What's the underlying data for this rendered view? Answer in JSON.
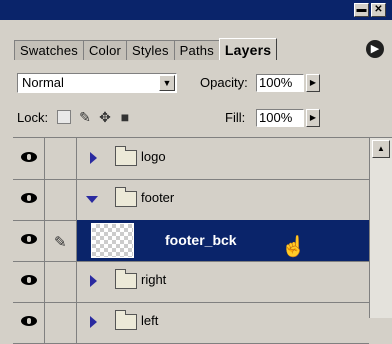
{
  "tabs": [
    {
      "label": "Swatches"
    },
    {
      "label": "Color"
    },
    {
      "label": "Styles"
    },
    {
      "label": "Paths"
    },
    {
      "label": "Layers"
    }
  ],
  "blend": {
    "mode": "Normal"
  },
  "opacity": {
    "label": "Opacity:",
    "value": "100%"
  },
  "lock": {
    "label": "Lock:"
  },
  "fill": {
    "label": "Fill:",
    "value": "100%"
  },
  "layers": [
    {
      "name": "logo"
    },
    {
      "name": "footer"
    },
    {
      "name": "footer_bck"
    },
    {
      "name": "right"
    },
    {
      "name": "left"
    }
  ],
  "colors": {
    "selection": "#0a246a",
    "panel": "#d4d0c8",
    "expander": "#2a2aa0"
  }
}
